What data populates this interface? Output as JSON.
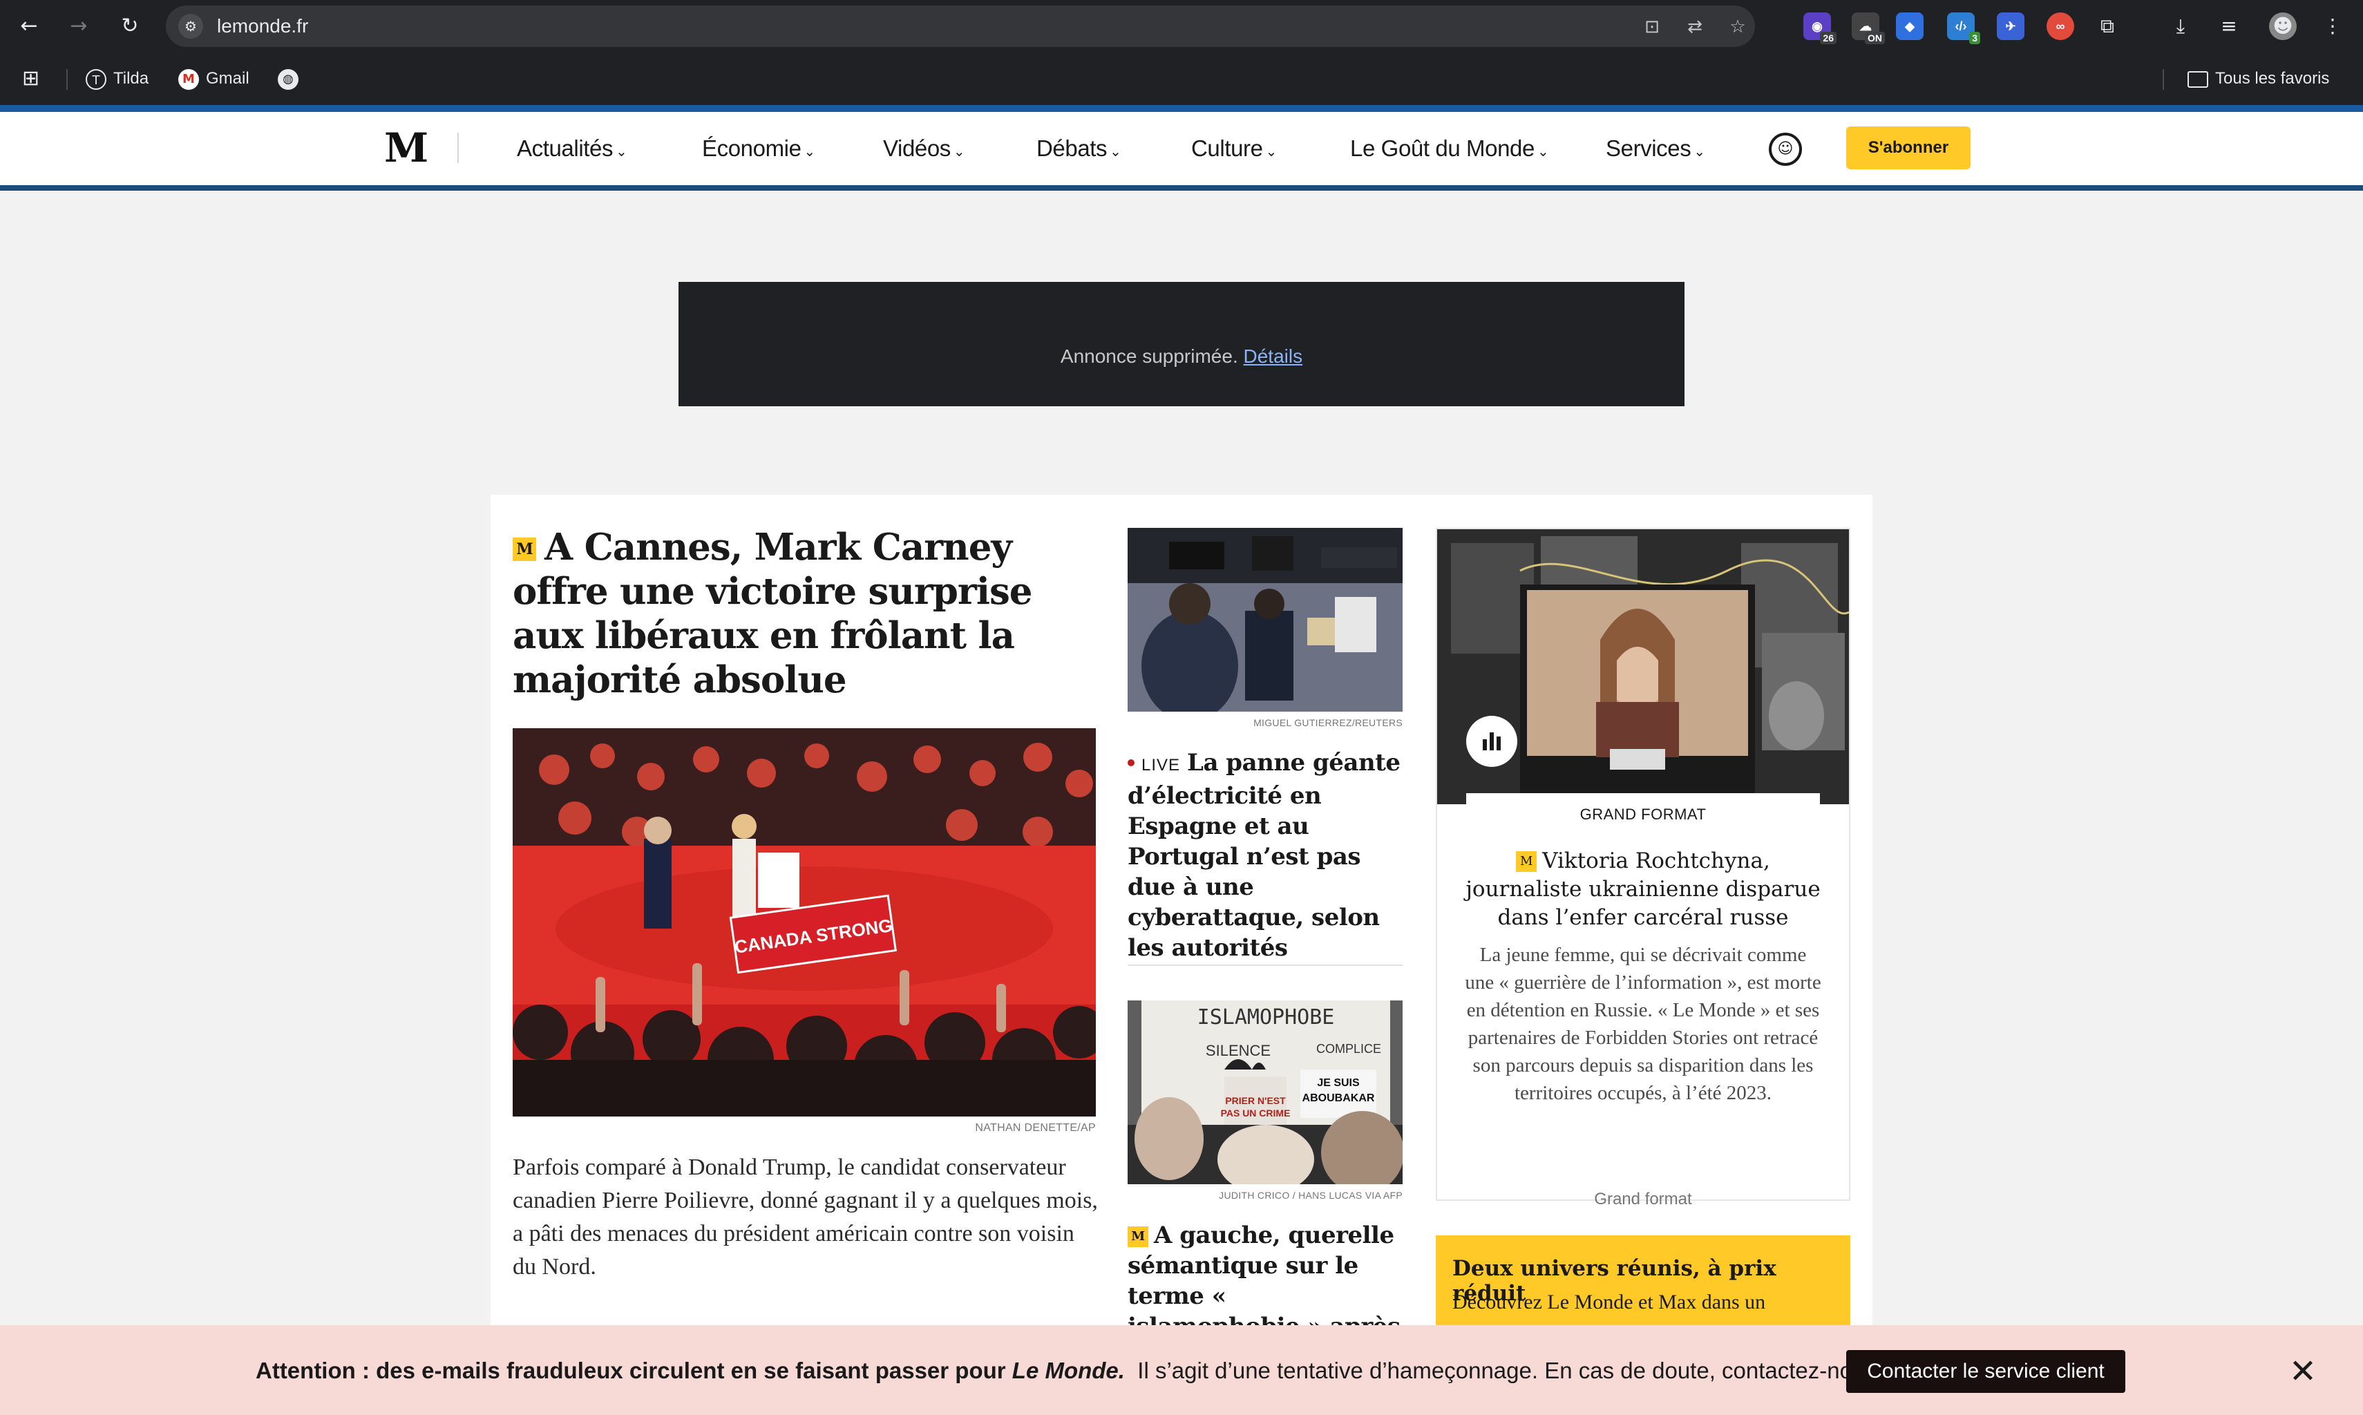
{
  "browser": {
    "url": "lemonde.fr",
    "bookmarks": [
      "Tilda",
      "Gmail"
    ],
    "all_bookmarks_label": "Tous les favoris",
    "extensions": [
      {
        "name": "ext-purple",
        "badge": "26"
      },
      {
        "name": "ext-on",
        "badge": "ON"
      },
      {
        "name": "ext-tag",
        "badge": ""
      },
      {
        "name": "ext-code",
        "badge": "3"
      },
      {
        "name": "ext-rocket",
        "badge": ""
      },
      {
        "name": "ext-red",
        "badge": ""
      }
    ]
  },
  "site": {
    "logo": "M",
    "nav": [
      "Actualités",
      "Économie",
      "Vidéos",
      "Débats",
      "Culture",
      "Le Goût du Monde",
      "Services"
    ],
    "subscribe_label": "S'abonner"
  },
  "ad": {
    "text": "Annonce supprimée.",
    "link": "Détails"
  },
  "lead": {
    "badge": "M",
    "title": "A Cannes, Mark Carney offre une victoire surprise aux libéraux en frôlant la majorité absolue",
    "photo_credit": "NATHAN DENETTE/AP",
    "photo_sign": "CANADA STRONG",
    "summary": "Parfois comparé à Donald Trump, le candidat conservateur canadien Pierre Poilievre, donné gagnant il y a quelques mois, a pâti des menaces du président américain contre son voisin du Nord."
  },
  "col2": {
    "photo1_credit": "MIGUEL GUTIERREZ/REUTERS",
    "live_label": "LIVE",
    "title1": "La panne géante d’électricité en Espagne et au Portugal n’est pas due à une cyberattaque, selon les autorités",
    "photo2_credit": "JUDITH CRICO / HANS LUCAS VIA AFP",
    "photo2_signs": [
      "ISLAMOPHOBE",
      "SILENCE",
      "COMPLICE",
      "JE SUIS",
      "ABOUBAKAR",
      "PRIER N'EST",
      "PAS UN CRIME"
    ],
    "title2": "A gauche, querelle sémantique sur le terme « islamophobie » après"
  },
  "grand_format": {
    "label": "GRAND FORMAT",
    "title": "Viktoria Rochtchyna, journaliste ukrainienne disparue dans l’enfer carcéral russe",
    "description": "La jeune femme, qui se décrivait comme une « guerrière de l’information », est morte en détention en Russie. « Le Monde » et ses partenaires de Forbidden Stories ont retracé son parcours depuis sa disparition dans les territoires occupés, à l’été 2023.",
    "link": "Grand format"
  },
  "promo": {
    "title": "Deux univers réunis, à prix réduit",
    "text": "Découvrez Le Monde et Max dans un"
  },
  "alert": {
    "bold": "Attention : des e-mails frauduleux circulent en se faisant passer pour",
    "brand": "Le Monde.",
    "rest": "Il s’agit d’une tentative d’hameçonnage. En cas de doute, contactez-nous.",
    "button": "Contacter le service client"
  },
  "colors": {
    "accent_yellow": "#ffc927",
    "header_blue": "#1a5aa0",
    "alert_bg": "#f7d9d6",
    "live_red": "#c41a1a"
  }
}
